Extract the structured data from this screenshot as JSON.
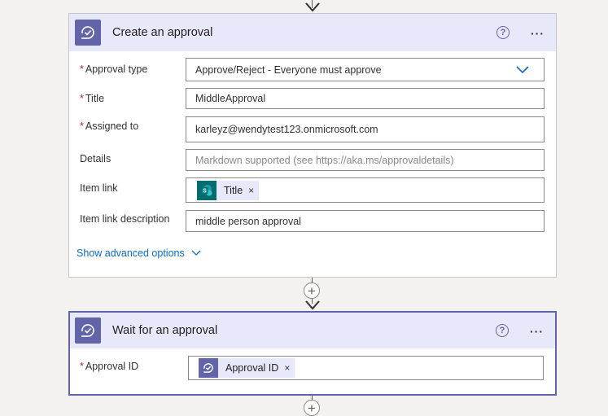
{
  "colors": {
    "accent": "#6264a7",
    "header_bg": "#e8e8fb",
    "required": "#a4262c",
    "link": "#0f6cbd",
    "sharepoint": "#036c70"
  },
  "create_approval": {
    "title": "Create an approval",
    "icon": "approval-icon",
    "help_icon": "?",
    "more_icon": "···",
    "fields": {
      "approval_type": {
        "required_mark": "*",
        "label": "Approval type",
        "value": "Approve/Reject - Everyone must approve"
      },
      "title": {
        "required_mark": "*",
        "label": "Title",
        "value": "MiddleApproval"
      },
      "assigned_to": {
        "required_mark": "*",
        "label": "Assigned to",
        "value": "karleyz@wendytest123.onmicrosoft.com"
      },
      "details": {
        "label": "Details",
        "placeholder": "Markdown supported (see https://aka.ms/approvaldetails)"
      },
      "item_link": {
        "label": "Item link",
        "token_icon": "sharepoint-icon",
        "token_label": "Title",
        "token_remove": "×"
      },
      "item_link_description": {
        "label": "Item link description",
        "value": "middle person approval"
      }
    },
    "show_advanced": "Show advanced options"
  },
  "connector": {
    "add_label": "+"
  },
  "wait_approval": {
    "title": "Wait for an approval",
    "icon": "approval-icon",
    "help_icon": "?",
    "more_icon": "···",
    "fields": {
      "approval_id": {
        "required_mark": "*",
        "label": "Approval ID",
        "token_icon": "approval-icon",
        "token_label": "Approval ID",
        "token_remove": "×"
      }
    }
  }
}
